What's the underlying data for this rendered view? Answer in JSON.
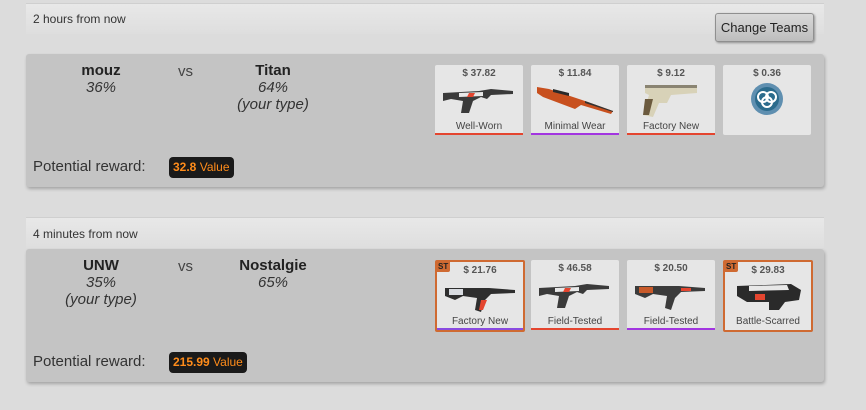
{
  "matches": [
    {
      "time": "2 hours from now",
      "change_teams_label": "Change Teams",
      "team1": {
        "name": "mouz",
        "pct": "36%",
        "note": ""
      },
      "vs": "vs",
      "team2": {
        "name": "Titan",
        "pct": "64%",
        "note": "(your type)"
      },
      "reward_label": "Potential reward:",
      "reward_value": "32.8",
      "reward_unit": "Value",
      "items": [
        {
          "price": "$ 37.82",
          "condition": "Well-Worn",
          "stattrak": false,
          "icon": "rifle-m4-icon",
          "bar": "#e4452f"
        },
        {
          "price": "$ 11.84",
          "condition": "Minimal Wear",
          "stattrak": false,
          "icon": "sniper-awp-icon",
          "bar": "#a235e0"
        },
        {
          "price": "$ 9.12",
          "condition": "Factory New",
          "stattrak": false,
          "icon": "pistol-deagle-icon",
          "bar": "#e4452f"
        },
        {
          "price": "$ 0.36",
          "condition": "",
          "stattrak": false,
          "icon": "team-sticker-icon",
          "bar": ""
        }
      ]
    },
    {
      "time": "4 minutes from now",
      "team1": {
        "name": "UNW",
        "pct": "35%",
        "note": "(your type)"
      },
      "vs": "vs",
      "team2": {
        "name": "Nostalgie",
        "pct": "65%",
        "note": ""
      },
      "reward_label": "Potential reward:",
      "reward_value": "215.99",
      "reward_unit": "Value",
      "items": [
        {
          "price": "$ 21.76",
          "condition": "Factory New",
          "stattrak": true,
          "st_label": "ST",
          "icon": "rifle-ak47-icon",
          "bar": "#8a4be0"
        },
        {
          "price": "$ 46.58",
          "condition": "Field-Tested",
          "stattrak": false,
          "icon": "rifle-m4-icon",
          "bar": "#e4452f"
        },
        {
          "price": "$ 20.50",
          "condition": "Field-Tested",
          "stattrak": false,
          "icon": "rifle-ak47-icon",
          "bar": "#a235e0"
        },
        {
          "price": "$ 29.83",
          "condition": "Battle-Scarred",
          "stattrak": true,
          "st_label": "ST",
          "icon": "smg-p90-icon",
          "bar": ""
        }
      ]
    }
  ]
}
